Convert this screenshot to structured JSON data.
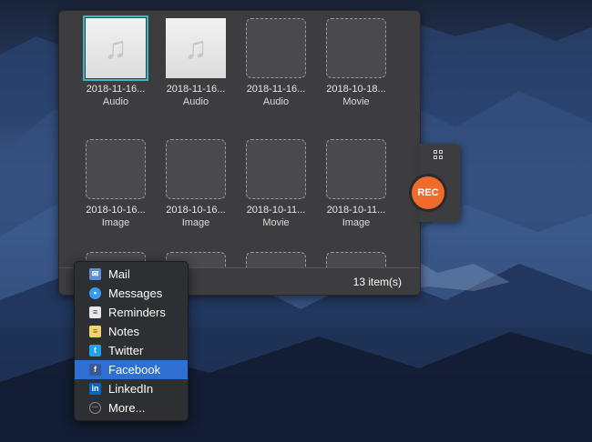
{
  "files": [
    {
      "name": "2018-11-16...",
      "type": "Audio",
      "has_thumb": true,
      "selected": true
    },
    {
      "name": "2018-11-16...",
      "type": "Audio",
      "has_thumb": true,
      "selected": false
    },
    {
      "name": "2018-11-16...",
      "type": "Audio",
      "has_thumb": false,
      "selected": false
    },
    {
      "name": "2018-10-18...",
      "type": "Movie",
      "has_thumb": false,
      "selected": false
    },
    {
      "name": "2018-10-16...",
      "type": "Image",
      "has_thumb": false,
      "selected": false
    },
    {
      "name": "2018-10-16...",
      "type": "Image",
      "has_thumb": false,
      "selected": false
    },
    {
      "name": "2018-10-11...",
      "type": "Movie",
      "has_thumb": false,
      "selected": false
    },
    {
      "name": "2018-10-11...",
      "type": "Image",
      "has_thumb": false,
      "selected": false
    }
  ],
  "footer": {
    "count": "13 item(s)"
  },
  "recorder": {
    "rec_label": "REC"
  },
  "share_menu": [
    {
      "label": "Mail",
      "icon": "mail-icon",
      "color": "#5a8fd6",
      "active": false
    },
    {
      "label": "Messages",
      "icon": "messages-icon",
      "color": "#3a9bf0",
      "active": false
    },
    {
      "label": "Reminders",
      "icon": "reminders-icon",
      "color": "#e8e8e8",
      "active": false
    },
    {
      "label": "Notes",
      "icon": "notes-icon",
      "color": "#f3d36b",
      "active": false
    },
    {
      "label": "Twitter",
      "icon": "twitter-icon",
      "color": "#1da1f2",
      "active": false
    },
    {
      "label": "Facebook",
      "icon": "facebook-icon",
      "color": "#3b5998",
      "active": true
    },
    {
      "label": "LinkedIn",
      "icon": "linkedin-icon",
      "color": "#0a66c2",
      "active": false
    },
    {
      "label": "More...",
      "icon": "more-icon",
      "color": "#8a8a8e",
      "active": false
    }
  ]
}
